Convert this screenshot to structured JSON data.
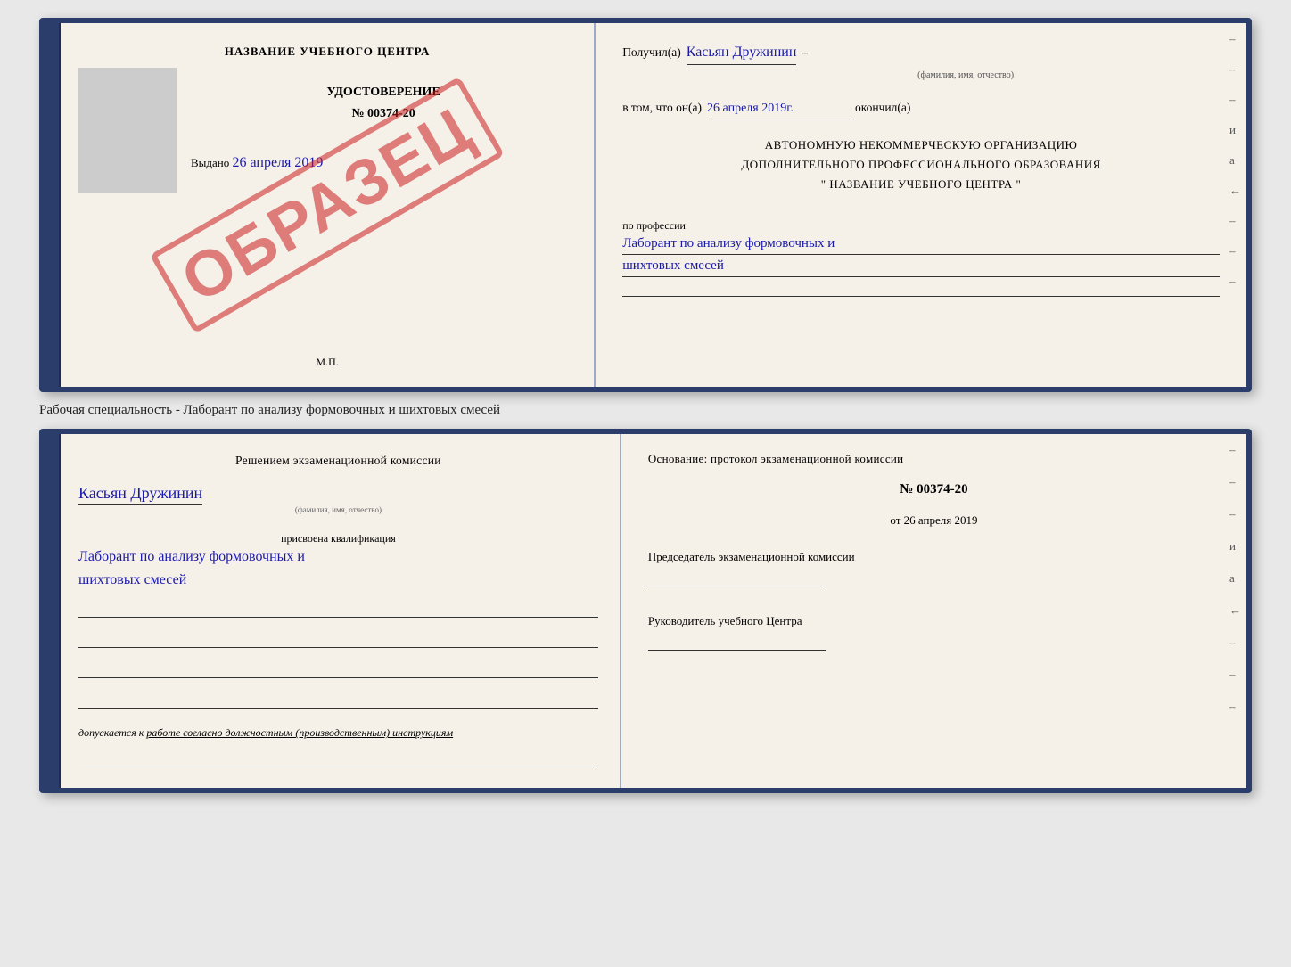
{
  "top_cert": {
    "left": {
      "header": "НАЗВАНИЕ УЧЕБНОГО ЦЕНТРА",
      "photo_alt": "photo",
      "id_title": "УДОСТОВЕРЕНИЕ",
      "id_number": "№ 00374-20",
      "issued_label": "Выдано",
      "issued_date": "26 апреля 2019",
      "mp_label": "М.П.",
      "stamp_text": "ОБРАЗЕЦ"
    },
    "right": {
      "received_label": "Получил(а)",
      "name_handwritten": "Касьян Дружинин",
      "name_subtext": "(фамилия, имя, отчество)",
      "in_that_label": "в том, что он(а)",
      "date_handwritten": "26 апреля 2019г.",
      "finished_label": "окончил(а)",
      "org_line1": "АВТОНОМНУЮ НЕКОММЕРЧЕСКУЮ ОРГАНИЗАЦИЮ",
      "org_line2": "ДОПОЛНИТЕЛЬНОГО ПРОФЕССИОНАЛЬНОГО ОБРАЗОВАНИЯ",
      "org_name": "\" НАЗВАНИЕ УЧЕБНОГО ЦЕНТРА \"",
      "profession_label": "по профессии",
      "profession_handwritten": "Лаборант по анализу формовочных и",
      "profession_handwritten2": "шихтовых смесей",
      "side_marks": [
        "–",
        "–",
        "–",
        "и",
        "а",
        "←",
        "–",
        "–",
        "–"
      ]
    }
  },
  "specialty_line": "Рабочая специальность - Лаборант по анализу формовочных и шихтовых смесей",
  "bottom_cert": {
    "left": {
      "komissia_text": "Решением  экзаменационной  комиссии",
      "name_handwritten": "Касьян Дружинин",
      "name_subtext": "(фамилия, имя, отчество)",
      "kvalf_label": "присвоена квалификация",
      "kvalf_hand1": "Лаборант по анализу формовочных и",
      "kvalf_hand2": "шихтовых смесей",
      "dopusk_prefix": "допускается к",
      "dopusk_text": " работе согласно должностным (производственным) инструкциям"
    },
    "right": {
      "osnov_text": "Основание: протокол экзаменационной  комиссии",
      "protocol_number": "№  00374-20",
      "protocol_date_prefix": "от",
      "protocol_date": "26 апреля 2019",
      "predsed_title": "Председатель экзаменационной комиссии",
      "ruk_title": "Руководитель учебного Центра",
      "side_marks": [
        "–",
        "–",
        "–",
        "и",
        "а",
        "←",
        "–",
        "–",
        "–"
      ]
    }
  }
}
